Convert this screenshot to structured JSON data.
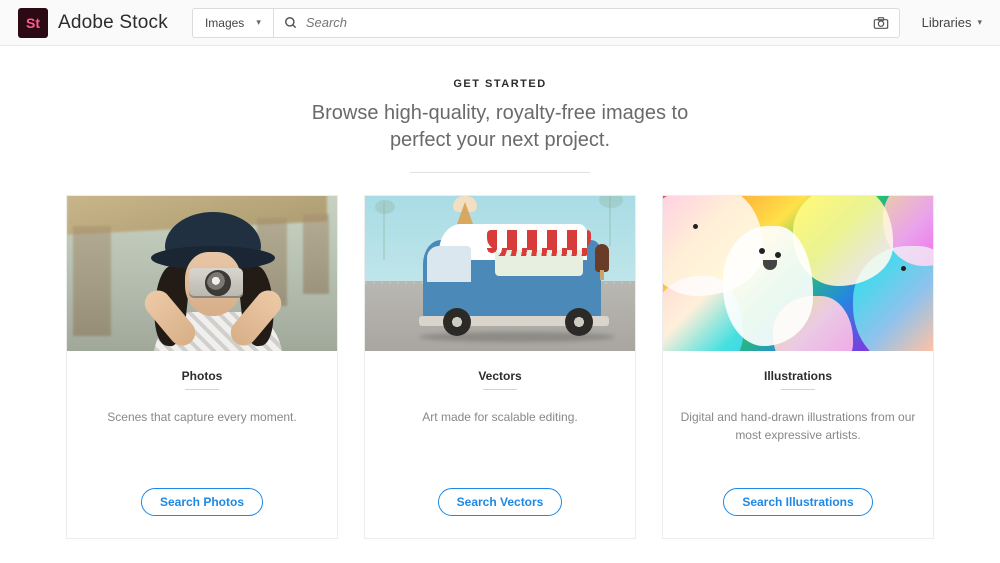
{
  "header": {
    "logo_text": "St",
    "brand": "Adobe Stock",
    "select_value": "Images",
    "search_placeholder": "Search",
    "libraries_label": "Libraries"
  },
  "hero": {
    "kicker": "GET STARTED",
    "subtitle_line1": "Browse high-quality, royalty-free images to",
    "subtitle_line2": "perfect your next project."
  },
  "cards": [
    {
      "title": "Photos",
      "desc": "Scenes that capture every moment.",
      "cta": "Search Photos"
    },
    {
      "title": "Vectors",
      "desc": "Art made for scalable editing.",
      "cta": "Search Vectors"
    },
    {
      "title": "Illustrations",
      "desc": "Digital and hand-drawn illustrations from our most expressive artists.",
      "cta": "Search Illustrations"
    }
  ]
}
